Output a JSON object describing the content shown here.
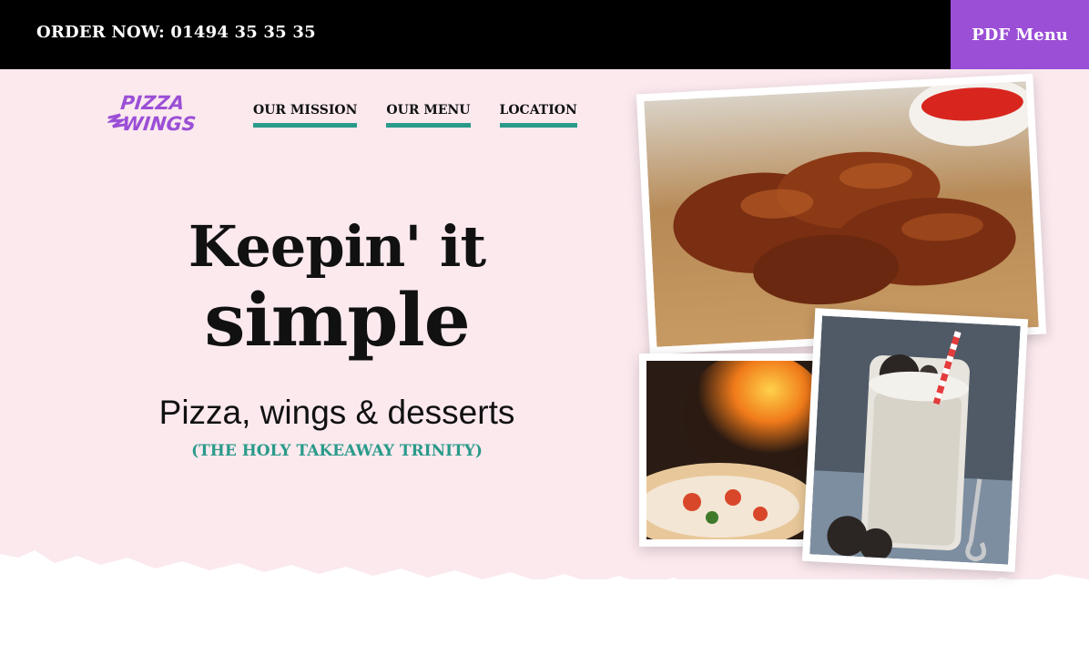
{
  "topbar": {
    "order_text": "ORDER NOW: 01494 35 35 35",
    "pdf_menu_label": "PDF Menu"
  },
  "brand": {
    "logo_line1": "PIZZA",
    "logo_line2": "WINGS",
    "purple": "#9b4fd6",
    "teal": "#2a9a8a",
    "hero_bg": "#fbe9ee"
  },
  "nav": {
    "items": [
      {
        "label": "OUR MISSION"
      },
      {
        "label": "OUR MENU"
      },
      {
        "label": "LOCATION"
      }
    ]
  },
  "hero": {
    "headline_line1": "Keepin' it",
    "headline_line2": "simple",
    "subtitle": "Pizza, wings & desserts",
    "tagline": "(THE HOLY TAKEAWAY TRINITY)"
  },
  "photos": [
    {
      "name": "wings-photo"
    },
    {
      "name": "pizza-photo"
    },
    {
      "name": "milkshake-photo"
    }
  ]
}
